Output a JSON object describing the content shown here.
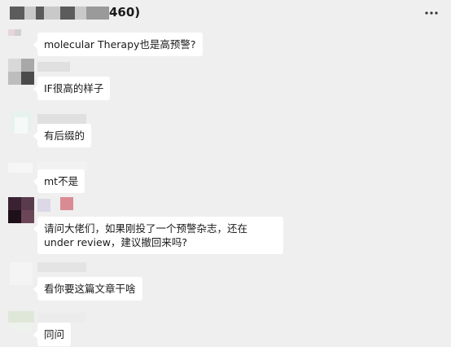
{
  "header": {
    "title_visible": "460)"
  },
  "messages": [
    {
      "text": "molecular Therapy也是高预警?"
    },
    {
      "text": "IF很高的样子"
    },
    {
      "text": "有后缀的"
    },
    {
      "text": "mt不是"
    },
    {
      "text": "请问大佬们，如果刚投了一个预警杂志，还在under review，建议撤回来吗?"
    },
    {
      "text": "看你要这篇文章干啥"
    },
    {
      "text": "同问"
    }
  ],
  "icons": {
    "more": "more-horizontal-icon"
  }
}
